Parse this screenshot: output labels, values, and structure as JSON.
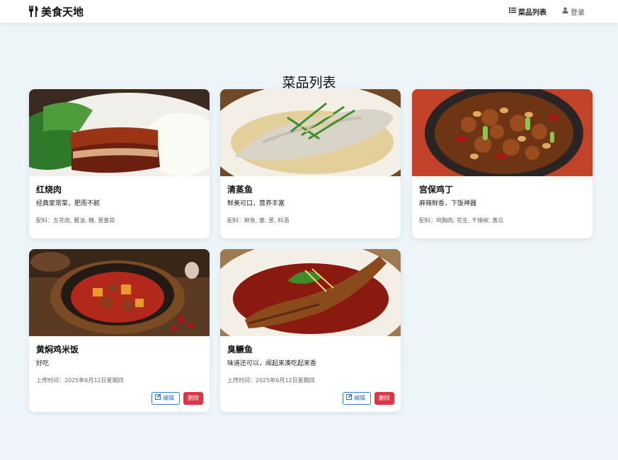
{
  "nav": {
    "brand": "美食天地",
    "links": [
      {
        "label": "菜品列表",
        "icon": "list-icon"
      },
      {
        "label": "登录",
        "icon": "user-icon"
      }
    ]
  },
  "page": {
    "title": "菜品列表"
  },
  "dishes": [
    {
      "name": "红烧肉",
      "description": "经典家常菜，肥而不腻",
      "meta": "配料：五花肉, 酱油, 糖, 葱姜蒜"
    },
    {
      "name": "清蒸鱼",
      "description": "鲜美可口，营养丰富",
      "meta": "配料：鲜鱼, 姜, 葱, 料酒"
    },
    {
      "name": "宫保鸡丁",
      "description": "麻辣鲜香，下饭神器",
      "meta": "配料：鸡胸肉, 花生, 干辣椒, 黄瓜"
    },
    {
      "name": "黄焖鸡米饭",
      "description": "好吃",
      "meta": "上传时间：2025年6月12日星期四"
    },
    {
      "name": "臭鳜鱼",
      "description": "味道还可以，闻起来凑吃起来香",
      "meta": "上传时间：2025年6月12日星期四"
    }
  ],
  "actions": {
    "edit_label": "编辑",
    "delete_label": "删除"
  },
  "colors": {
    "primary": "#3a7bd5",
    "danger": "#dc3545",
    "navbar_bg": "#ffffff"
  }
}
